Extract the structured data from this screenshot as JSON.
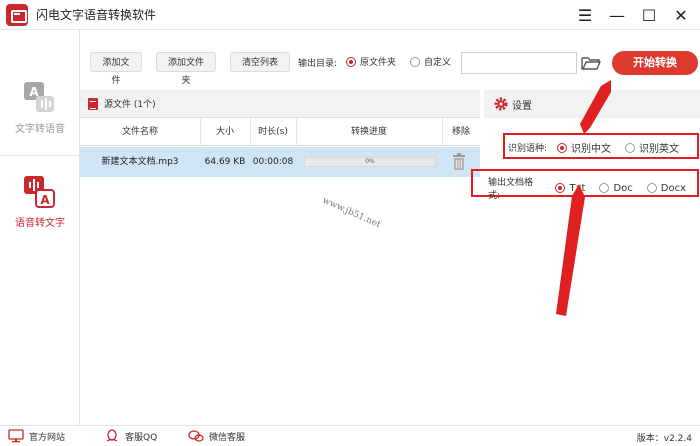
{
  "app": {
    "title": "闪电文字语音转换软件"
  },
  "window_controls": {
    "menu": "☰",
    "minimize": "—",
    "maximize": "☐",
    "close": "✕"
  },
  "sidebar": {
    "items": [
      {
        "label": "文字转语音",
        "icon": "text-to-speech-icon",
        "active": false
      },
      {
        "label": "语音转文字",
        "icon": "speech-to-text-icon",
        "active": true
      }
    ]
  },
  "toolbar": {
    "add_file": "添加文件",
    "add_folder": "添加文件夹",
    "clear_list": "清空列表",
    "output_label": "输出目录:",
    "output_options": [
      "原文件夹",
      "自定义"
    ],
    "output_selected": "原文件夹",
    "path_value": "",
    "start": "开始转换"
  },
  "file_panel": {
    "title": "源文件 (1个)",
    "columns": [
      "文件名称",
      "大小",
      "时长(s)",
      "转换进度",
      "移除"
    ],
    "rows": [
      {
        "name": "新建文本文档.mp3",
        "size": "64.69 KB",
        "duration": "00:00:08",
        "progress": "0%",
        "progress_value": 0
      }
    ]
  },
  "settings": {
    "title": "设置",
    "language_label": "识别语种:",
    "languages": [
      "识别中文",
      "识别英文"
    ],
    "language_selected": "识别中文",
    "format_label": "输出文档格式:",
    "formats": [
      "Txt",
      "Doc",
      "Docx"
    ],
    "format_selected": "Txt"
  },
  "watermark": "www.jb51.net",
  "statusbar": {
    "website": "官方网站",
    "qq": "客服QQ",
    "wechat": "微信客服",
    "version": "版本：v2.2.4"
  },
  "colors": {
    "accent": "#c9282d",
    "start_button": "#dc3a2e",
    "selected_row": "#cfe5f6",
    "annotation": "#e02020"
  }
}
